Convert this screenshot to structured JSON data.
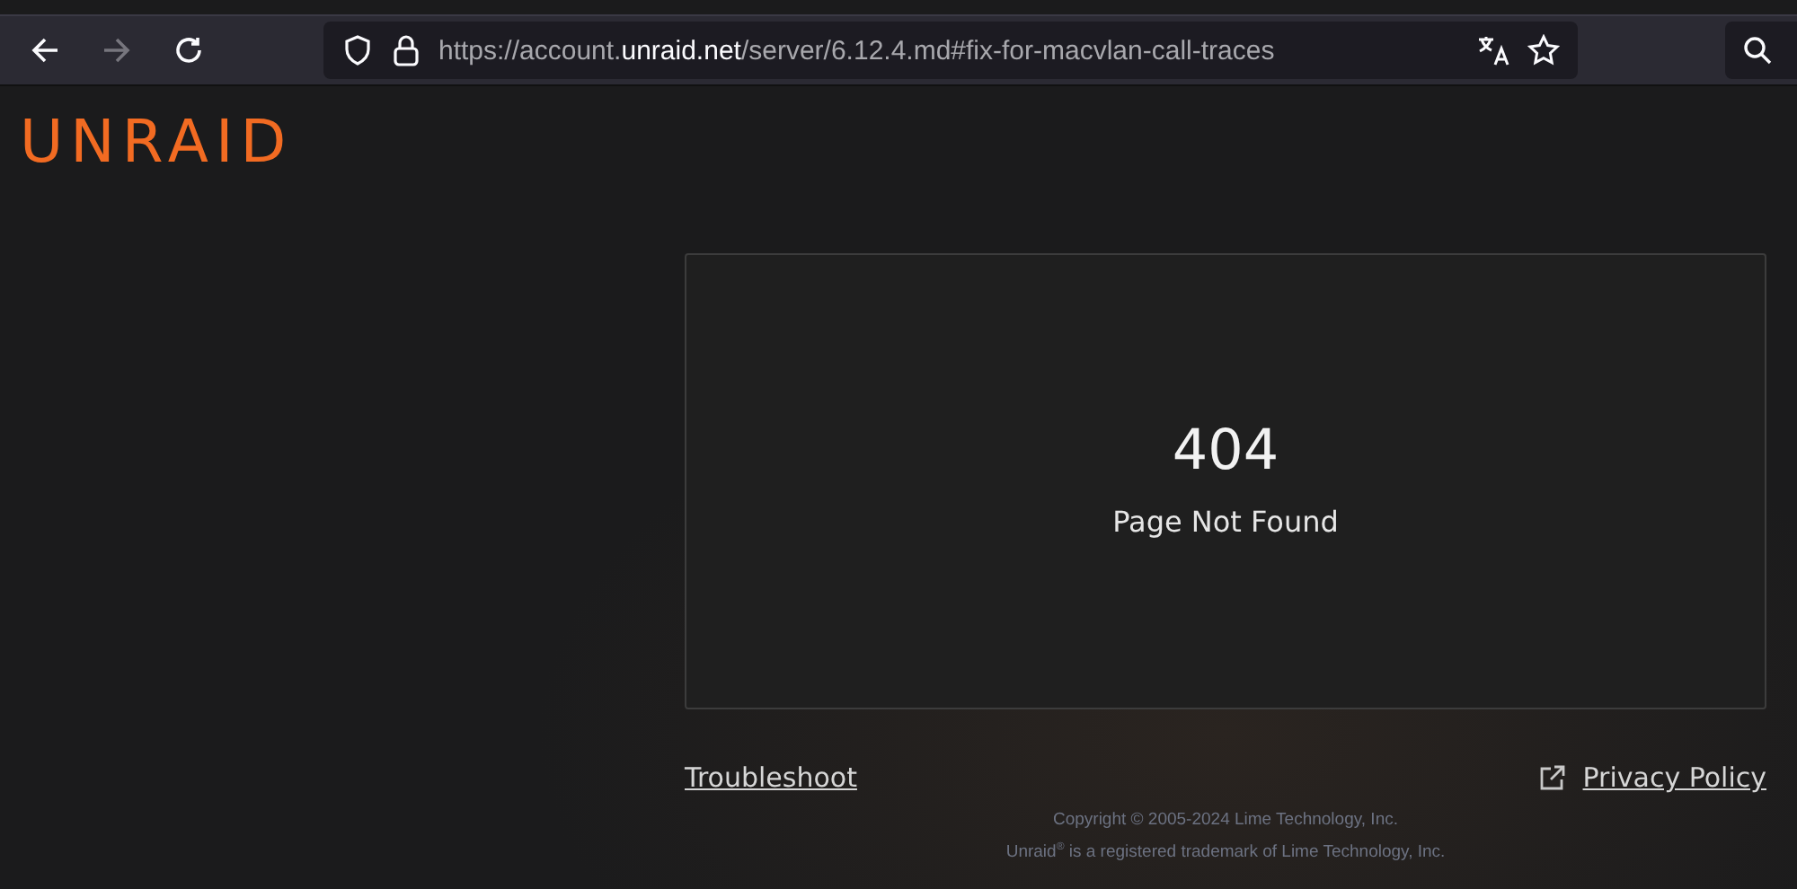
{
  "browser": {
    "url": {
      "scheme_host": "https://account.",
      "domain": "unraid.net",
      "path": "/server/6.12.4.md#fix-for-macvlan-call-traces"
    },
    "back_disabled": false,
    "forward_disabled": true
  },
  "logo": "UNRAID",
  "error": {
    "code": "404",
    "message": "Page Not Found"
  },
  "footer": {
    "troubleshoot": "Troubleshoot",
    "privacy": "Privacy Policy",
    "copyright": "Copyright © 2005-2024 Lime Technology, Inc.",
    "trademark": "Unraid$^{®}$ is a registered trademark of Lime Technology, Inc."
  }
}
